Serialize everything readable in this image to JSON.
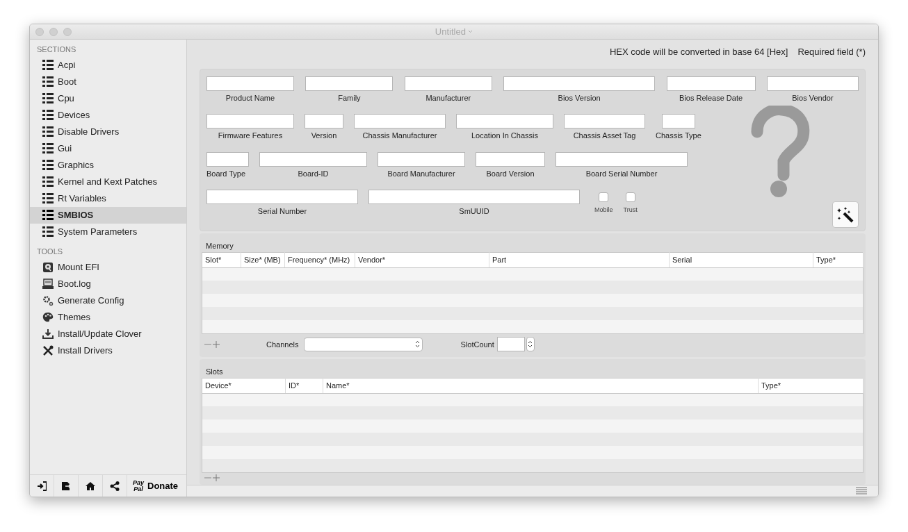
{
  "window": {
    "title": "Untitled"
  },
  "sidebar": {
    "sections_heading": "SECTIONS",
    "sections": [
      {
        "label": "Acpi",
        "selected": false
      },
      {
        "label": "Boot",
        "selected": false
      },
      {
        "label": "Cpu",
        "selected": false
      },
      {
        "label": "Devices",
        "selected": false
      },
      {
        "label": "Disable Drivers",
        "selected": false
      },
      {
        "label": "Gui",
        "selected": false
      },
      {
        "label": "Graphics",
        "selected": false
      },
      {
        "label": "Kernel and Kext Patches",
        "selected": false
      },
      {
        "label": "Rt Variables",
        "selected": false
      },
      {
        "label": "SMBIOS",
        "selected": true
      },
      {
        "label": "System Parameters",
        "selected": false
      }
    ],
    "tools_heading": "TOOLS",
    "tools": [
      {
        "label": "Mount EFI",
        "kind": "disk"
      },
      {
        "label": "Boot.log",
        "kind": "log"
      },
      {
        "label": "Generate Config",
        "kind": "gears"
      },
      {
        "label": "Themes",
        "kind": "palette"
      },
      {
        "label": "Install/Update Clover",
        "kind": "download"
      },
      {
        "label": "Install Drivers",
        "kind": "tools"
      }
    ]
  },
  "bottom_toolbar": {
    "buttons": [
      {
        "kind": "import"
      },
      {
        "kind": "export"
      },
      {
        "kind": "home"
      },
      {
        "kind": "share"
      }
    ],
    "donate": {
      "brand_top": "Pay",
      "brand_bottom": "Pal",
      "label": "Donate"
    }
  },
  "header": {
    "hex_note": "HEX code will be converted in base 64 [Hex]",
    "required_note": "Required field (*)"
  },
  "smbios_fields": [
    [
      {
        "label": "Product Name"
      },
      {
        "label": "Family"
      },
      {
        "label": "Manufacturer"
      },
      {
        "label": "Bios Version"
      },
      {
        "label": "Bios Release Date"
      },
      {
        "label": "Bios Vendor"
      }
    ],
    [
      {
        "label": "Firmware Features"
      },
      {
        "label": "Version"
      },
      {
        "label": "Chassis Manufacturer"
      },
      {
        "label": "Location In Chassis"
      },
      {
        "label": "Chassis  Asset Tag"
      },
      {
        "label": "Chassis Type"
      }
    ],
    [
      {
        "label": "Board Type"
      },
      {
        "label": "Board-ID"
      },
      {
        "label": "Board Manufacturer"
      },
      {
        "label": "Board Version"
      },
      {
        "label": "Board Serial Number"
      }
    ],
    [
      {
        "label": "Serial Number"
      },
      {
        "label": "SmUUID"
      }
    ]
  ],
  "checkboxes": [
    {
      "label": "Mobile",
      "checked": false
    },
    {
      "label": "Trust",
      "checked": false
    }
  ],
  "memory": {
    "title": "Memory",
    "columns": [
      "Slot*",
      "Size* (MB)",
      "Frequency* (MHz)",
      "Vendor*",
      "Part",
      "Serial",
      "Type*"
    ],
    "channels_label": "Channels",
    "slotcount_label": "SlotCount"
  },
  "slots": {
    "title": "Slots",
    "columns": [
      "Device*",
      "ID*",
      "Name*",
      "Type*"
    ]
  }
}
